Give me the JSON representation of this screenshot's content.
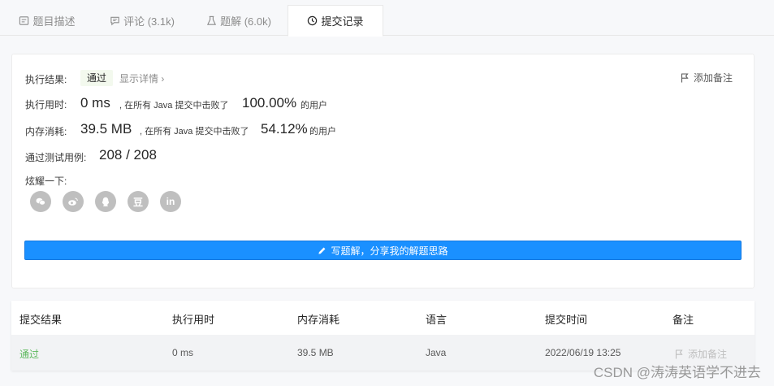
{
  "tabs": [
    {
      "label": "题目描述",
      "icon": "document-icon"
    },
    {
      "label": "评论 (3.1k)",
      "icon": "comment-icon"
    },
    {
      "label": "题解 (6.0k)",
      "icon": "flask-icon"
    },
    {
      "label": "提交记录",
      "icon": "clock-icon",
      "active": true
    }
  ],
  "result": {
    "status_label": "执行结果:",
    "status_value": "通过",
    "detail_link": "显示详情 ›",
    "add_note": "添加备注",
    "time_label": "执行用时:",
    "time_value": "0 ms",
    "time_mid": ", 在所有 Java 提交中击败了",
    "time_percent": "100.00%",
    "time_suffix": "的用户",
    "mem_label": "内存消耗:",
    "mem_value": "39.5 MB",
    "mem_mid": ", 在所有 Java 提交中击败了",
    "mem_percent": "54.12%",
    "mem_suffix": "的用户",
    "cases_label": "通过测试用例:",
    "cases_value": "208 / 208",
    "share_label": "炫耀一下:",
    "share_icons": [
      "wechat-icon",
      "weibo-icon",
      "qq-icon",
      "douban-icon",
      "linkedin-icon"
    ],
    "douban_glyph": "豆",
    "linkedin_glyph": "in",
    "write_button": "写题解，分享我的解题思路"
  },
  "table": {
    "headers": [
      "提交结果",
      "执行用时",
      "内存消耗",
      "语言",
      "提交时间",
      "备注"
    ],
    "rows": [
      {
        "result": "通过",
        "time": "0 ms",
        "memory": "39.5 MB",
        "language": "Java",
        "submitted": "2022/06/19 13:25",
        "note": "添加备注"
      }
    ]
  },
  "watermark": "CSDN @涛涛英语学不进去",
  "colors": {
    "accent": "#1a90ff",
    "pass": "#5cb85c",
    "badge_bg": "#f3f9ee"
  }
}
